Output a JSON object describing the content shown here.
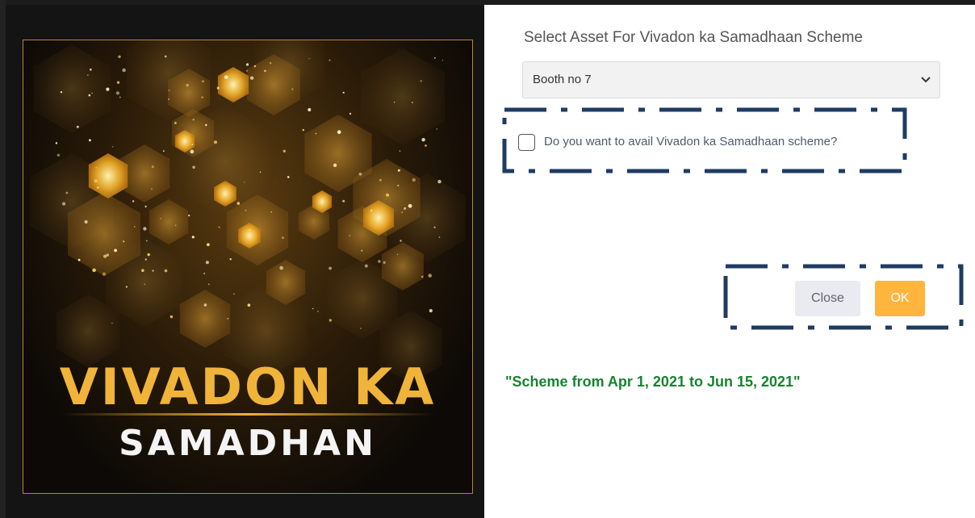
{
  "poster": {
    "title_line1": "VIVADON KA",
    "title_line2": "SAMADHAN",
    "colors": {
      "gold": "#f0b43a",
      "white": "#f4f4f4"
    }
  },
  "form": {
    "select_label": "Select Asset For Vivadon ka Samadhaan Scheme",
    "select_value": "Booth no 7",
    "checkbox_label": "Do you want to avail Vivadon ka Samadhaan scheme?",
    "checkbox_checked": false
  },
  "buttons": {
    "close_label": "Close",
    "ok_label": "OK"
  },
  "scheme_note": "\"Scheme from Apr 1, 2021 to Jun 15, 2021\"",
  "icons": {
    "dropdown": "chevron-down-icon"
  },
  "colors": {
    "highlight_border": "#1f3b62",
    "ok_button": "#ffb53e",
    "close_button": "#e9ebf0",
    "note_text": "#178331"
  }
}
